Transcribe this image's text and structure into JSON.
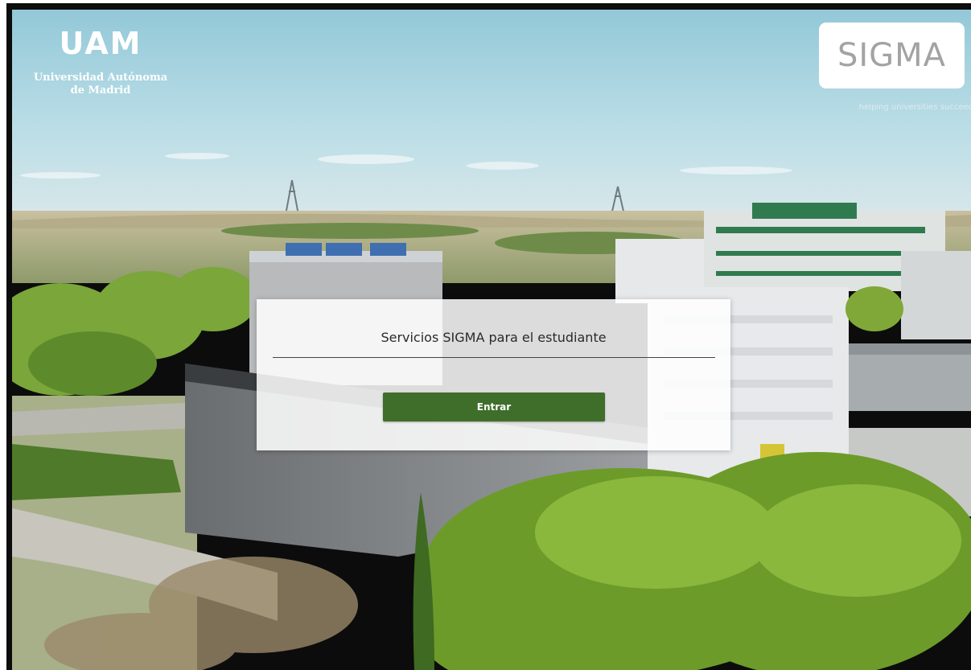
{
  "uam_logo": {
    "mark": "UAM",
    "name_line1": "Universidad Autónoma",
    "name_line2": "de Madrid"
  },
  "sigma_logo": {
    "mark": "SIGMA",
    "tagline": "helping universities succeed"
  },
  "login_card": {
    "title": "Servicios SIGMA para el estudiante",
    "enter_label": "Entrar"
  },
  "colors": {
    "button": "#3e6e2a",
    "card": "#ffffff",
    "sky": "#a9d3df"
  }
}
